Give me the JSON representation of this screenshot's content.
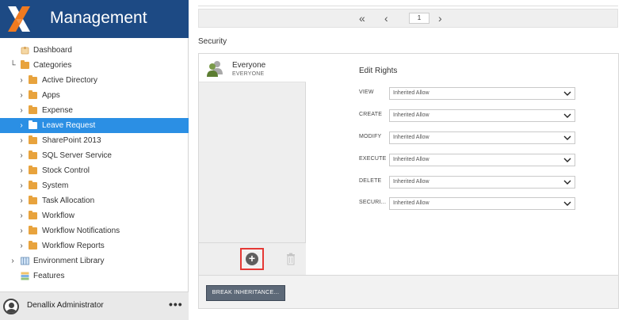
{
  "app": {
    "title": "Management"
  },
  "sidebar": {
    "items": [
      {
        "label": "Dashboard",
        "type": "dashboard",
        "level": 0
      },
      {
        "label": "Categories",
        "type": "folder-open",
        "level": 0,
        "expanded": true
      },
      {
        "label": "Active Directory",
        "type": "folder",
        "level": 1
      },
      {
        "label": "Apps",
        "type": "folder",
        "level": 1
      },
      {
        "label": "Expense",
        "type": "folder",
        "level": 1
      },
      {
        "label": "Leave Request",
        "type": "folder",
        "level": 1,
        "selected": true
      },
      {
        "label": "SharePoint 2013",
        "type": "folder",
        "level": 1
      },
      {
        "label": "SQL Server Service",
        "type": "folder",
        "level": 1
      },
      {
        "label": "Stock Control",
        "type": "folder",
        "level": 1
      },
      {
        "label": "System",
        "type": "folder",
        "level": 1
      },
      {
        "label": "Task Allocation",
        "type": "folder",
        "level": 1
      },
      {
        "label": "Workflow",
        "type": "folder",
        "level": 1
      },
      {
        "label": "Workflow Notifications",
        "type": "folder",
        "level": 1
      },
      {
        "label": "Workflow Reports",
        "type": "folder",
        "level": 1
      },
      {
        "label": "Environment Library",
        "type": "library",
        "level": 0
      },
      {
        "label": "Features",
        "type": "features",
        "level": 0
      }
    ],
    "user": {
      "name": "Denallix Administrator",
      "more": "•••"
    }
  },
  "pager": {
    "current_page": "1"
  },
  "security": {
    "heading": "Security",
    "principals": [
      {
        "name": "Everyone",
        "id": "EVERYONE"
      }
    ],
    "rights_title": "Edit Rights",
    "rights": [
      {
        "label": "VIEW",
        "value": "Inherited Allow"
      },
      {
        "label": "CREATE",
        "value": "Inherited Allow"
      },
      {
        "label": "MODIFY",
        "value": "Inherited Allow"
      },
      {
        "label": "EXECUTE",
        "value": "Inherited Allow"
      },
      {
        "label": "DELETE",
        "value": "Inherited Allow"
      },
      {
        "label": "SECURI...",
        "value": "Inherited Allow"
      }
    ],
    "break_label": "BREAK INHERITANCE..."
  },
  "colors": {
    "brand": "#1d4a84",
    "selected": "#2b8fe4",
    "folder": "#e8a33d",
    "highlight": "#e53935",
    "button": "#5d6978"
  }
}
